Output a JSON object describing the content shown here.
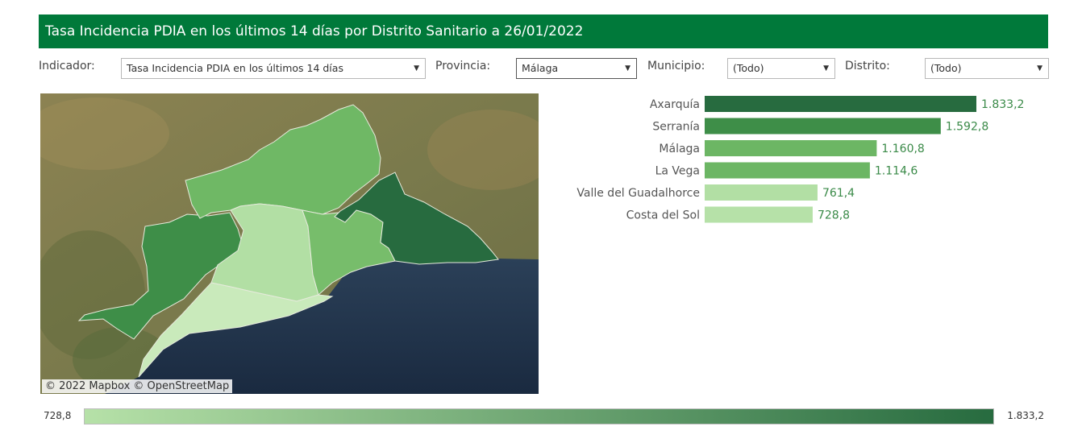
{
  "header": {
    "title": "Tasa Incidencia PDIA en los últimos 14 días por Distrito Sanitario a 26/01/2022"
  },
  "filters": {
    "indicator": {
      "label": "Indicador:",
      "value": "Tasa Incidencia PDIA en los últimos 14 días"
    },
    "province": {
      "label": "Provincia:",
      "value": "Málaga"
    },
    "municipality": {
      "label": "Municipio:",
      "value": "(Todo)"
    },
    "district": {
      "label": "Distrito:",
      "value": "(Todo)"
    }
  },
  "map": {
    "attribution": "© 2022 Mapbox  © OpenStreetMap",
    "districts": [
      {
        "id": "serrania",
        "color": "#3e8e48"
      },
      {
        "id": "la-vega",
        "color": "#6fb865"
      },
      {
        "id": "valle-del-guadalhorce",
        "color": "#b2dfa4"
      },
      {
        "id": "costa-del-sol",
        "color": "#c9eabb"
      },
      {
        "id": "malaga",
        "color": "#77bd6b"
      },
      {
        "id": "axarquia",
        "color": "#276b3f"
      }
    ]
  },
  "chart_data": {
    "type": "bar",
    "orientation": "horizontal",
    "categories": [
      "Axarquía",
      "Serranía",
      "Málaga",
      "La Vega",
      "Valle del Guadalhorce",
      "Costa del Sol"
    ],
    "values": [
      1833.2,
      1592.8,
      1160.8,
      1114.6,
      761.4,
      728.8
    ],
    "value_labels": [
      "1.833,2",
      "1.592,8",
      "1.160,8",
      "1.114,6",
      "761,4",
      "728,8"
    ],
    "colors": [
      "#276b3f",
      "#3e8e48",
      "#6cb664",
      "#6cb664",
      "#b2dfa4",
      "#b6e1a8"
    ],
    "xlim": [
      0,
      1833.2
    ],
    "grid": false
  },
  "legend": {
    "min_label": "728,8",
    "max_label": "1.833,2",
    "gradient_start": "#b6e1a8",
    "gradient_end": "#276b3f"
  }
}
